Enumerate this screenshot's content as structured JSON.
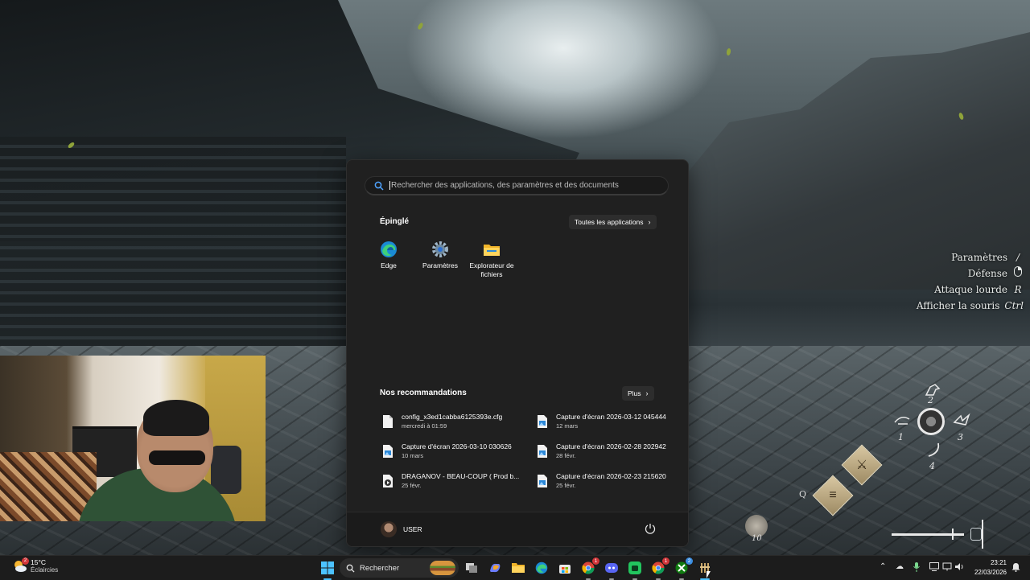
{
  "game_hud": {
    "controls": [
      {
        "label": "Paramètres",
        "key": "/"
      },
      {
        "label": "Défense",
        "key": ""
      },
      {
        "label": "Attaque lourde",
        "key": "R"
      },
      {
        "label": "Afficher la souris",
        "key": "Ctrl"
      }
    ],
    "wheel_numbers": [
      "2",
      "1",
      "3",
      "4"
    ],
    "q_key": "Q",
    "item_count": "10"
  },
  "start_menu": {
    "search_placeholder": "Rechercher des applications, des paramètres et des documents",
    "pinned_title": "Épinglé",
    "all_apps_label": "Toutes les applications",
    "pinned": [
      {
        "label": "Edge",
        "icon": "edge-icon"
      },
      {
        "label": "Paramètres",
        "icon": "settings-gear-icon"
      },
      {
        "label": "Explorateur de fichiers",
        "icon": "folder-icon"
      }
    ],
    "recommended_title": "Nos recommandations",
    "more_label": "Plus",
    "recommendations": [
      {
        "name": "config_x3ed1cabba6125393e.cfg",
        "sub": "mercredi à 01:59",
        "icon": "file-icon"
      },
      {
        "name": "Capture d'écran 2026-03-12 045444",
        "sub": "12 mars",
        "icon": "image-file-icon"
      },
      {
        "name": "Capture d'écran 2026-03-10 030626",
        "sub": "10 mars",
        "icon": "image-file-icon"
      },
      {
        "name": "Capture d'écran 2026-02-28 202942",
        "sub": "28 févr.",
        "icon": "image-file-icon"
      },
      {
        "name": "DRAGANOV - BEAU-COUP ( Prod b...",
        "sub": "25 févr.",
        "icon": "media-file-icon"
      },
      {
        "name": "Capture d'écran 2026-02-23 215620",
        "sub": "25 févr.",
        "icon": "image-file-icon"
      }
    ],
    "user_name": "USER"
  },
  "taskbar": {
    "weather_temp": "15°C",
    "weather_desc": "Éclaircies",
    "weather_badge": "2",
    "search_label": "Rechercher",
    "badges": {
      "chrome": "1",
      "chrome2": "1",
      "xbox": "2"
    },
    "time": "23:21",
    "date": "22/03/2026"
  }
}
